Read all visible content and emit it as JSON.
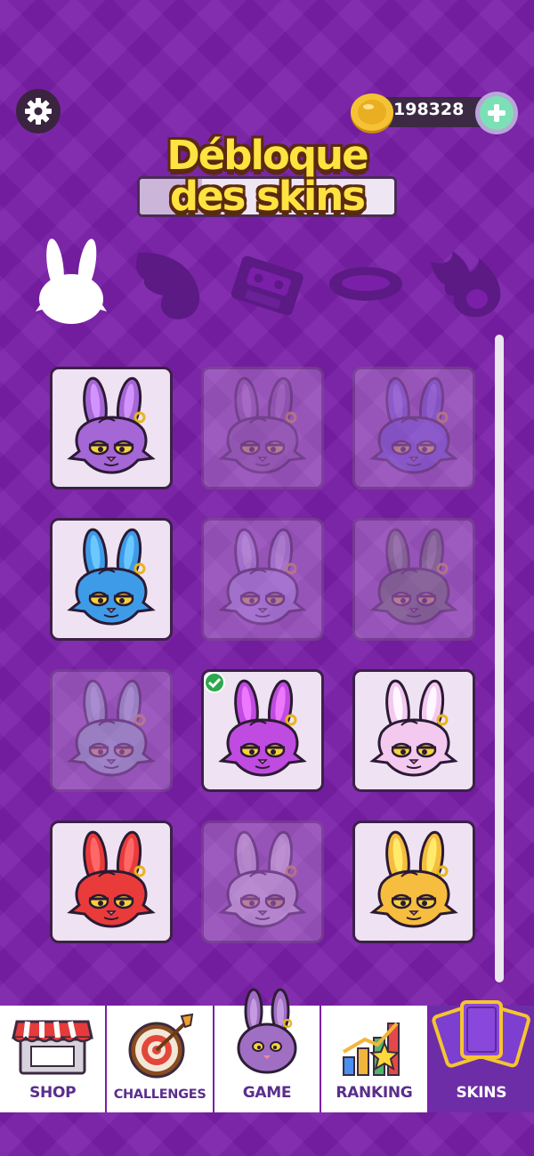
{
  "header": {
    "coins": "198328",
    "title_line1": "Débloque",
    "title_line2": "des skins"
  },
  "categories": [
    {
      "name": "bunny-head",
      "active": true
    },
    {
      "name": "wing",
      "active": false
    },
    {
      "name": "cassette",
      "active": false
    },
    {
      "name": "ring",
      "active": false
    },
    {
      "name": "fire",
      "active": false
    }
  ],
  "skins": [
    {
      "color": "#a566d6",
      "locked": false,
      "selected": false
    },
    {
      "color": "#8a5aa6",
      "locked": true,
      "selected": false
    },
    {
      "color": "#6a59e6",
      "locked": true,
      "selected": false
    },
    {
      "color": "#3e9be8",
      "locked": false,
      "selected": false
    },
    {
      "color": "#b9a8f5",
      "locked": true,
      "selected": false
    },
    {
      "color": "#627a55",
      "locked": true,
      "selected": false
    },
    {
      "color": "#9fd8d6",
      "locked": true,
      "selected": false
    },
    {
      "color": "#c04be0",
      "locked": false,
      "selected": true
    },
    {
      "color": "#f3c9f0",
      "locked": false,
      "selected": false
    },
    {
      "color": "#ea3b3b",
      "locked": false,
      "selected": false
    },
    {
      "color": "#f2eef6",
      "locked": true,
      "selected": false
    },
    {
      "color": "#f6bd3e",
      "locked": false,
      "selected": false
    }
  ],
  "nav": {
    "shop": "SHOP",
    "challenges": "CHALLENGES",
    "game": "GAME",
    "ranking": "RANKING",
    "skins": "SKINS",
    "active": "skins"
  },
  "colors": {
    "background": "#7a1fa8",
    "title_yellow": "#ffe340",
    "nav_active": "#6d2da6"
  }
}
